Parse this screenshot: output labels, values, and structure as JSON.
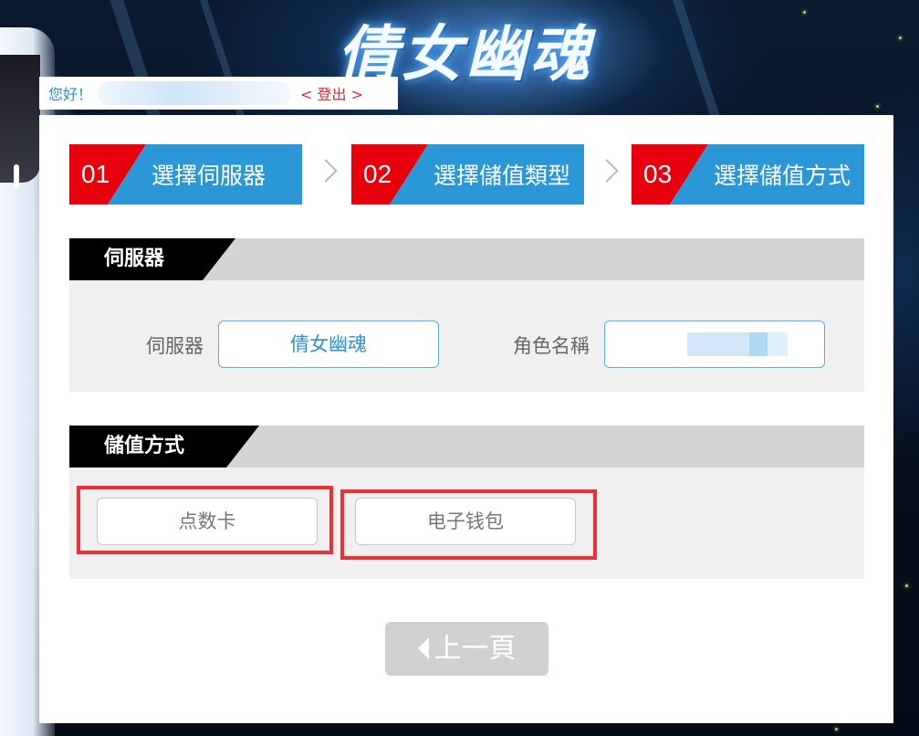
{
  "header": {
    "logo_text": "倩女幽魂",
    "greeting": "您好！",
    "logout_label": "< 登出 >"
  },
  "steps": [
    {
      "number": "01",
      "label": "選擇伺服器"
    },
    {
      "number": "02",
      "label": "選擇儲值類型"
    },
    {
      "number": "03",
      "label": "選擇儲值方式"
    }
  ],
  "server_section": {
    "title": "伺服器",
    "server_label": "伺服器",
    "server_value": "倩女幽魂",
    "role_label": "角色名稱"
  },
  "payment_section": {
    "title": "儲值方式",
    "options": [
      {
        "label": "点数卡"
      },
      {
        "label": "电子钱包"
      }
    ]
  },
  "nav": {
    "prev_label": "上一頁"
  },
  "colors": {
    "step_number_red": "#e8000d",
    "step_blue": "#2c97d6",
    "link_blue": "#2a8fd6",
    "highlight_red": "#ee2f36",
    "section_header_black": "#000000"
  }
}
